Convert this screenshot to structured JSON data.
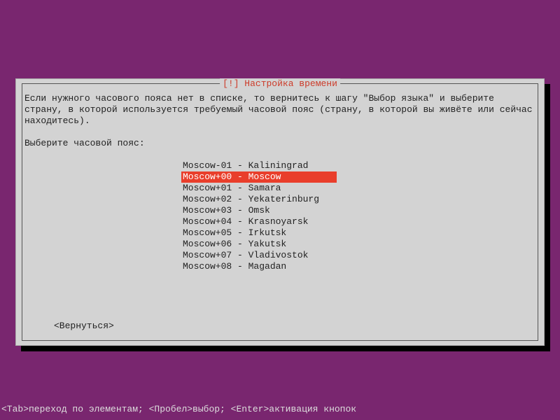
{
  "dialog": {
    "title": "[!] Настройка времени",
    "instruction": "Если нужного часового пояса нет в списке, то вернитесь к шагу \"Выбор языка\" и выберите страну, в которой используется требуемый часовой пояс (страну, в которой вы живёте или сейчас находитесь).",
    "prompt": "Выберите часовой пояс:",
    "back_label": "<Вернуться>"
  },
  "timezones": [
    {
      "label": "Moscow-01 - Kaliningrad",
      "selected": false
    },
    {
      "label": "Moscow+00 - Moscow",
      "selected": true
    },
    {
      "label": "Moscow+01 - Samara",
      "selected": false
    },
    {
      "label": "Moscow+02 - Yekaterinburg",
      "selected": false
    },
    {
      "label": "Moscow+03 - Omsk",
      "selected": false
    },
    {
      "label": "Moscow+04 - Krasnoyarsk",
      "selected": false
    },
    {
      "label": "Moscow+05 - Irkutsk",
      "selected": false
    },
    {
      "label": "Moscow+06 - Yakutsk",
      "selected": false
    },
    {
      "label": "Moscow+07 - Vladivostok",
      "selected": false
    },
    {
      "label": "Moscow+08 - Magadan",
      "selected": false
    }
  ],
  "footer": {
    "hint": "<Tab>переход по элементам; <Пробел>выбор; <Enter>активация кнопок"
  }
}
